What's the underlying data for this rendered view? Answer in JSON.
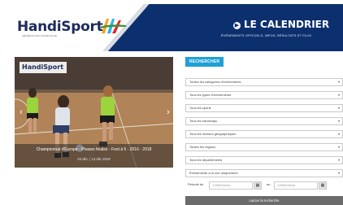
{
  "header": {
    "logo_text": "HandiSport",
    "logo_subtext": "FÉDÉRATION FRANÇAISE",
    "title": "LE CALENDRIER",
    "subtitle": "ÉVÉNEMENTS OFFICIELS, INFOS, RÉSULTATS ET PLUS"
  },
  "featured": {
    "logo_text": "HandiSport",
    "title": "Championnat d'Europe - Phases finales - Foot à 5 - 2016 - 2018",
    "date": "04 déc. | 13 déc 2018"
  },
  "filters": {
    "search_label": "RECHERCHER",
    "selects": [
      "Toutes les catégories d'événements",
      "Tous les types d'événements",
      "Tous les sports",
      "Tous les handicaps",
      "Tous les niveaux géographiques",
      "Toutes les régions",
      "Tous les départements",
      "Événements à la une uniquement"
    ],
    "period_from_label": "Période du",
    "period_to_label": "au",
    "date_placeholder": "JJ/MM/AAAA",
    "launch_label": "Lancer la recherche"
  },
  "colors": {
    "banner": "#0c2f6e",
    "accent": "#1fa1d6",
    "button": "#6b6b6b"
  }
}
